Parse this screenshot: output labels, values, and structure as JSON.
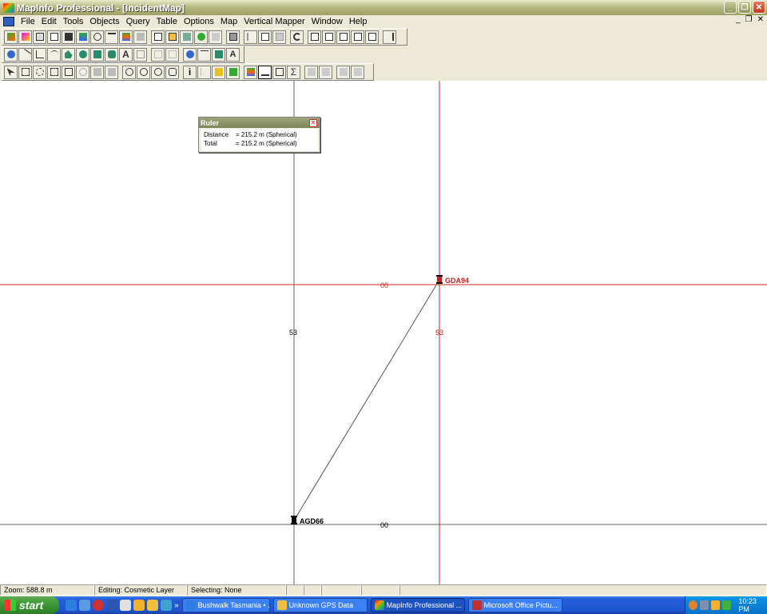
{
  "window": {
    "title": "MapInfo Professional - [IncidentMap]",
    "minimize": "_",
    "restore": "❐",
    "close": "✕"
  },
  "menubar": {
    "items": [
      "File",
      "Edit",
      "Tools",
      "Objects",
      "Query",
      "Table",
      "Options",
      "Map",
      "Vertical Mapper",
      "Window",
      "Help"
    ],
    "mdi_minimize": "_",
    "mdi_restore": "❐",
    "mdi_close": "✕"
  },
  "ruler_window": {
    "title": "Ruler",
    "rows": [
      {
        "label": "Distance",
        "value": "= 215.2 m (Spherical)"
      },
      {
        "label": "Total",
        "value": "= 215.2 m (Spherical)"
      }
    ]
  },
  "map": {
    "grid_labels": [
      {
        "text": "00",
        "color": "#d42424"
      },
      {
        "text": "53",
        "color": "#000000"
      },
      {
        "text": "53",
        "color": "#d42424"
      },
      {
        "text": "00",
        "color": "#000000"
      }
    ],
    "points": [
      {
        "name": "GDA94",
        "color": "#c82020"
      },
      {
        "name": "AGD66",
        "color": "#000000"
      }
    ],
    "red_grid_color": "#d42424",
    "black_grid_color": "#606060"
  },
  "statusbar": {
    "zoom": "Zoom: 588.8 m",
    "editing": "Editing: Cosmetic Layer",
    "selecting": "Selecting: None"
  },
  "taskbar": {
    "start_label": "start",
    "quick_overflow": "»",
    "tasks": [
      {
        "label": "Bushwalk Tasmania • ...",
        "icon_color": "#2f7fe0"
      },
      {
        "label": "Unknown GPS Data",
        "icon_color": "#f0c040"
      },
      {
        "label": "MapInfo Professional ...",
        "icon_color": "#e04040"
      },
      {
        "label": "Microsoft Office Pictu...",
        "icon_color": "#c03030"
      }
    ],
    "clock": "10:23 PM"
  }
}
